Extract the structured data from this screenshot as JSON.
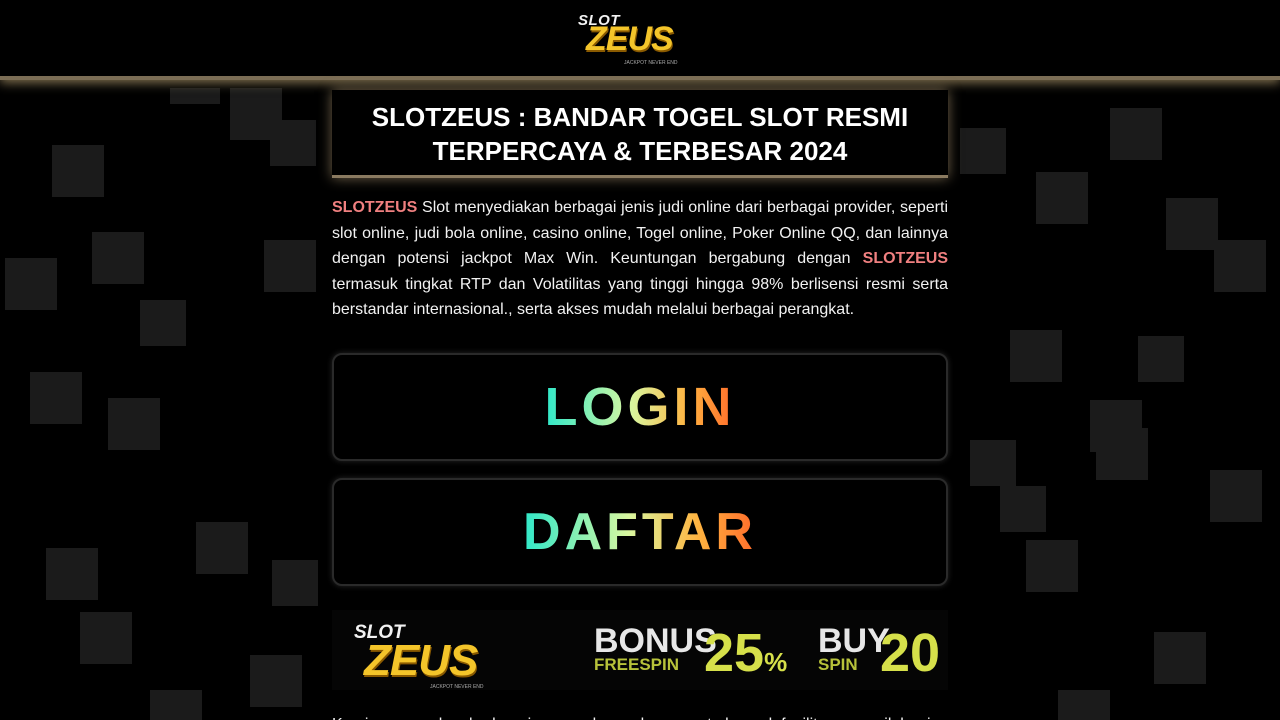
{
  "header": {
    "logo_top": "SLOT",
    "logo_main": "ZEUS",
    "logo_tagline": "JACKPOT NEVER END"
  },
  "title": {
    "line1": "SLOTZEUS : BANDAR TOGEL SLOT RESMI",
    "line2": "TERPERCAYA & TERBESAR 2024"
  },
  "intro": {
    "brand1": "SLOTZEUS",
    "part1": " Slot menyediakan berbagai jenis judi online dari berbagai provider, seperti slot online, judi bola online, casino online, Togel online, Poker Online QQ, dan lainnya dengan potensi jackpot Max Win. Keuntungan bergabung dengan ",
    "brand2": "SLOTZEUS",
    "part2": " termasuk tingkat RTP dan Volatilitas yang tinggi hingga 98% berlisensi resmi serta berstandar internasional., serta akses mudah melalui berbagai perangkat."
  },
  "buttons": {
    "login": "LOGIN",
    "register": "DAFTAR"
  },
  "banner": {
    "logo_top": "SLOT",
    "logo_main": "ZEUS",
    "logo_tagline": "JACKPOT NEVER END",
    "bonus_line1": "BONUS",
    "bonus_line2": "FREESPIN",
    "bonus_value": "25",
    "bonus_unit": "%",
    "buy_line1": "BUY",
    "buy_line2": "SPIN",
    "buy_value": "20"
  },
  "outro": {
    "text": "Kami menawarkan berbagai macam bonus besar serta banyak fasilitas menarik bagi"
  },
  "colors": {
    "brand_highlight": "#f08080",
    "gold": "#f4c52a",
    "background": "#000000"
  }
}
